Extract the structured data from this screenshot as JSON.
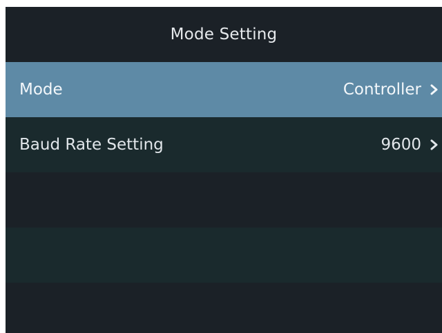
{
  "header": {
    "title": "Mode Setting"
  },
  "rows": [
    {
      "label": "Mode",
      "value": "Controller"
    },
    {
      "label": "Baud Rate Setting",
      "value": "9600"
    }
  ],
  "colors": {
    "background": "#1b2127",
    "selected_row": "#5e8aa6",
    "alt_row": "#1a2a2d",
    "text": "#e1e6ea"
  },
  "icons": {
    "row_chevron": "chevron-right-icon"
  }
}
